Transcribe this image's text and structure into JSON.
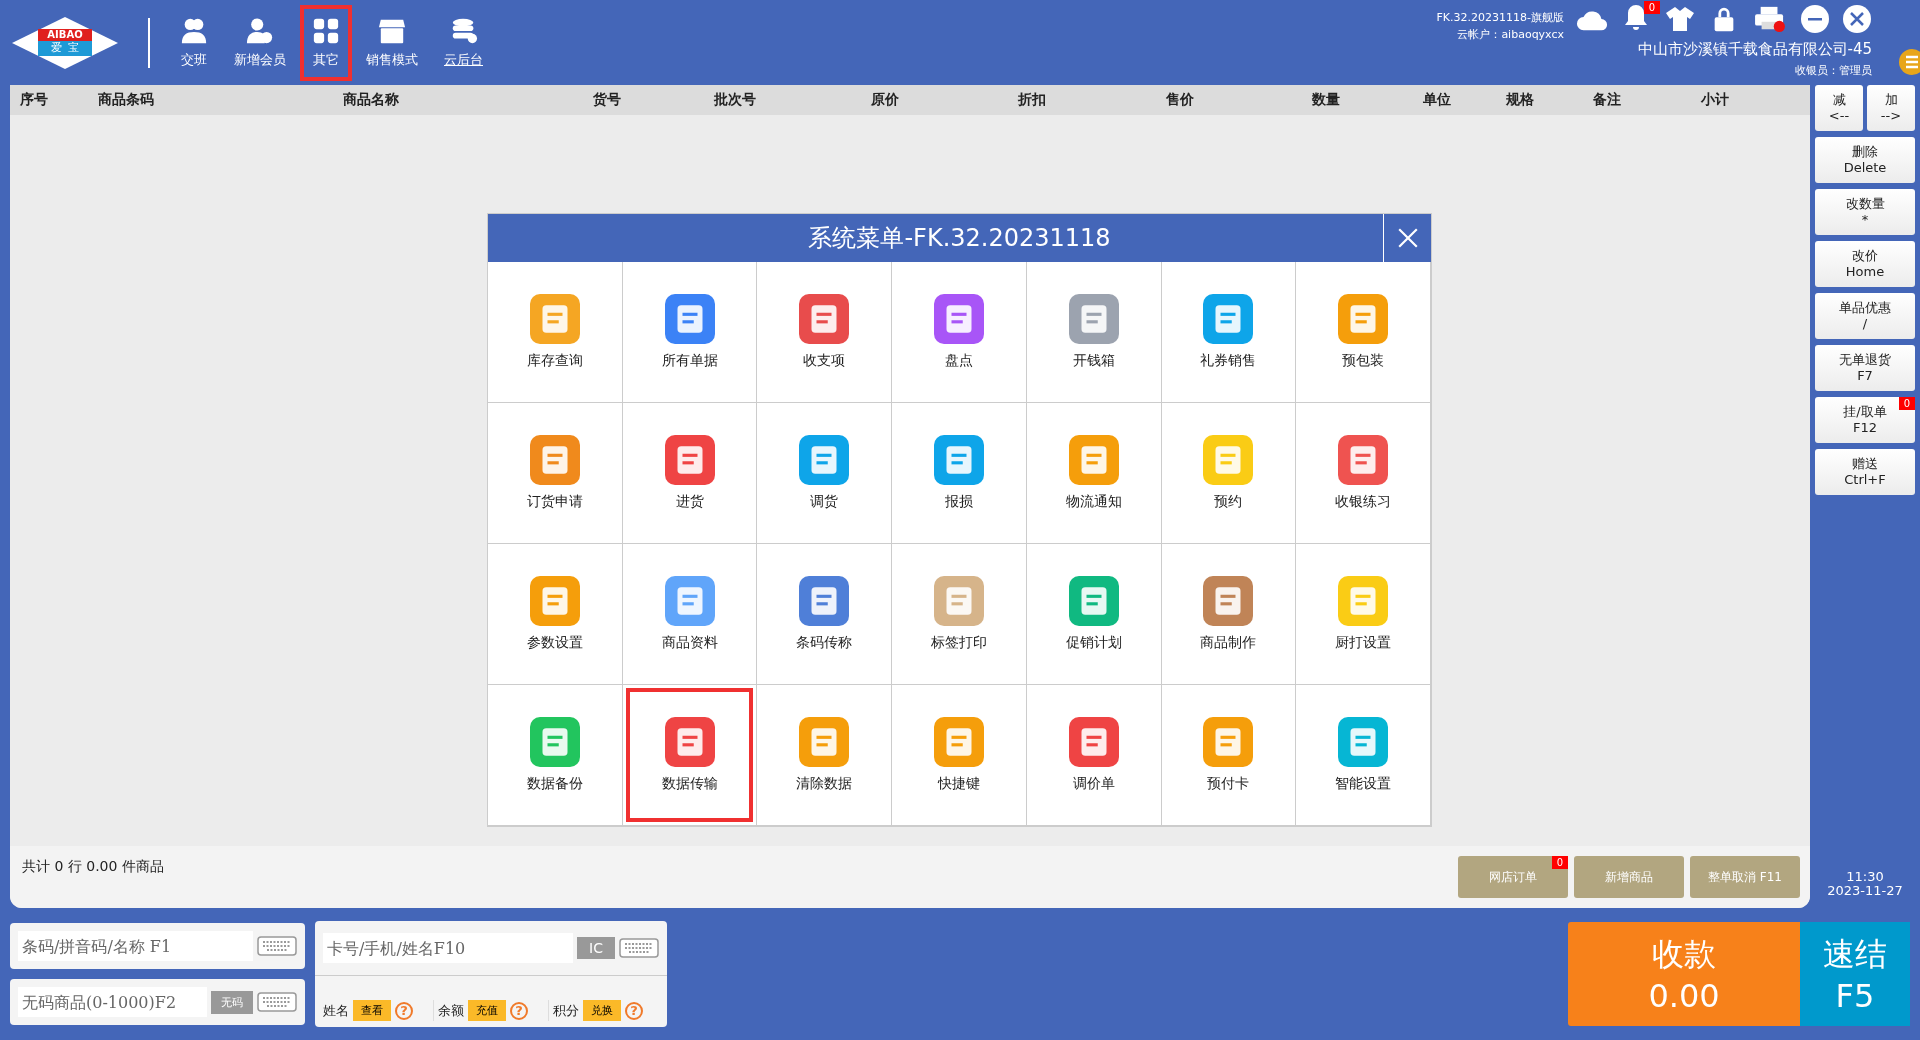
{
  "logo": {
    "top": "AIBAO",
    "bottom": "爱  宝"
  },
  "toolbar": [
    {
      "label": "交班",
      "highlighted": false,
      "underlined": false
    },
    {
      "label": "新增会员",
      "highlighted": false,
      "underlined": false
    },
    {
      "label": "其它",
      "highlighted": true,
      "underlined": false
    },
    {
      "label": "销售模式",
      "highlighted": false,
      "underlined": false
    },
    {
      "label": "云后台",
      "highlighted": false,
      "underlined": true
    }
  ],
  "version": "FK.32.20231118-旗舰版",
  "cloud_account": "云帐户：aibaoqyxcx",
  "notification_count": "0",
  "company": "中山市沙溪镇千载食品有限公司-45",
  "cashier": "收银员：管理员",
  "table": {
    "columns": [
      "序号",
      "商品条码",
      "商品名称",
      "货号",
      "批次号",
      "原价",
      "折扣",
      "售价",
      "数量",
      "单位",
      "规格",
      "备注",
      "小计"
    ]
  },
  "dialog": {
    "title": "系统菜单-FK.32.20231118",
    "items": [
      {
        "label": "库存查询",
        "highlighted": false
      },
      {
        "label": "所有单据",
        "highlighted": false
      },
      {
        "label": "收支项",
        "highlighted": false
      },
      {
        "label": "盘点",
        "highlighted": false
      },
      {
        "label": "开钱箱",
        "highlighted": false
      },
      {
        "label": "礼券销售",
        "highlighted": false
      },
      {
        "label": "预包装",
        "highlighted": false
      },
      {
        "label": "订货申请",
        "highlighted": false
      },
      {
        "label": "进货",
        "highlighted": false
      },
      {
        "label": "调货",
        "highlighted": false
      },
      {
        "label": "报损",
        "highlighted": false
      },
      {
        "label": "物流通知",
        "highlighted": false
      },
      {
        "label": "预约",
        "highlighted": false
      },
      {
        "label": "收银练习",
        "highlighted": false
      },
      {
        "label": "参数设置",
        "highlighted": false
      },
      {
        "label": "商品资料",
        "highlighted": false
      },
      {
        "label": "条码传称",
        "highlighted": false
      },
      {
        "label": "标签打印",
        "highlighted": false
      },
      {
        "label": "促销计划",
        "highlighted": false
      },
      {
        "label": "商品制作",
        "highlighted": false
      },
      {
        "label": "厨打设置",
        "highlighted": false
      },
      {
        "label": "数据备份",
        "highlighted": false
      },
      {
        "label": "数据传输",
        "highlighted": true
      },
      {
        "label": "清除数据",
        "highlighted": false
      },
      {
        "label": "快捷键",
        "highlighted": false
      },
      {
        "label": "调价单",
        "highlighted": false
      },
      {
        "label": "预付卡",
        "highlighted": false
      },
      {
        "label": "智能设置",
        "highlighted": false
      }
    ]
  },
  "summary": "共计 0 行 0.00 件商品",
  "footer_buttons": [
    {
      "label": "网店订单",
      "badge": "0"
    },
    {
      "label": "新增商品"
    },
    {
      "label": "整单取消 F11"
    }
  ],
  "side_buttons": [
    {
      "line1": "删除",
      "line2": "Delete"
    },
    {
      "line1": "改数量",
      "line2": "*"
    },
    {
      "line1": "改价",
      "line2": "Home"
    },
    {
      "line1": "单品优惠",
      "line2": "/"
    },
    {
      "line1": "无单退货",
      "line2": "F7"
    },
    {
      "line1": "挂/取单",
      "line2": "F12",
      "badge": "0"
    },
    {
      "line1": "赠送",
      "line2": "Ctrl+F"
    }
  ],
  "minus_button": {
    "line1": "减",
    "line2": "<--"
  },
  "plus_button": {
    "line1": "加",
    "line2": "-->"
  },
  "time": "11:30",
  "date": "2023-11-27",
  "barcode_field": {
    "placeholder": "条码/拼音码/名称 F1"
  },
  "nocode_field": {
    "placeholder": "无码商品(0-1000)F2",
    "button": "无码"
  },
  "member_field": {
    "placeholder": "卡号/手机/姓名F10",
    "button": "IC"
  },
  "member_info": [
    {
      "label": "姓名",
      "button": "查看"
    },
    {
      "label": "余额",
      "button": "充值"
    },
    {
      "label": "积分",
      "button": "兑换"
    }
  ],
  "help_mark": "?",
  "pay_button": {
    "label": "收款",
    "amount": "0.00"
  },
  "quick_button": {
    "label": "速结",
    "key": "F5"
  }
}
